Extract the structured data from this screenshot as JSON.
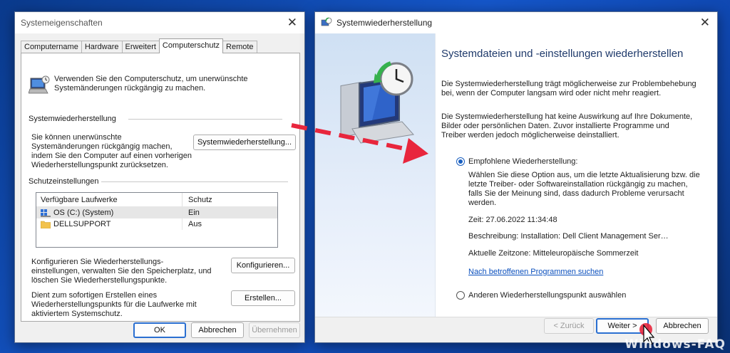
{
  "left_window": {
    "title": "Systemeigenschaften",
    "tabs": [
      {
        "label": "Computername"
      },
      {
        "label": "Hardware"
      },
      {
        "label": "Erweitert"
      },
      {
        "label": "Computerschutz",
        "active": true
      },
      {
        "label": "Remote"
      }
    ],
    "intro_text_1": "Verwenden Sie den Computerschutz, um unerwünschte",
    "intro_text_2": "Systemänderungen rückgängig zu machen.",
    "restore_section": {
      "label": "Systemwiederherstellung",
      "text_1": "Sie können unerwünschte",
      "text_2": "Systemänderungen rückgängig machen,",
      "text_3": "indem Sie den Computer auf einen vorherigen",
      "text_4": "Wiederherstellungspunkt zurücksetzen.",
      "button": "Systemwiederherstellung..."
    },
    "protection_section": {
      "label": "Schutzeinstellungen",
      "columns": [
        "Verfügbare Laufwerke",
        "Schutz"
      ],
      "rows": [
        {
          "drive": "OS (C:) (System)",
          "protection": "Ein",
          "icon": "system-drive-icon"
        },
        {
          "drive": "DELLSUPPORT",
          "protection": "Aus",
          "icon": "folder-icon"
        }
      ]
    },
    "configure": {
      "text_1": "Konfigurieren Sie Wiederherstellungs-",
      "text_2": "einstellungen, verwalten Sie den Speicherplatz, und",
      "text_3": "löschen Sie Wiederherstellungspunkte.",
      "button": "Konfigurieren..."
    },
    "create": {
      "text_1": "Dient zum sofortigen Erstellen eines",
      "text_2": "Wiederherstellungspunkts für die Laufwerke mit",
      "text_3": "aktiviertem Systemschutz.",
      "button": "Erstellen..."
    },
    "footer": {
      "ok": "OK",
      "cancel": "Abbrechen",
      "apply": "Übernehmen"
    }
  },
  "right_window": {
    "title": "Systemwiederherstellung",
    "heading": "Systemdateien und -einstellungen wiederherstellen",
    "para1_1": "Die Systemwiederherstellung trägt möglicherweise zur Problembehebung",
    "para1_2": "bei, wenn der Computer langsam wird oder nicht mehr reagiert.",
    "para2_1": "Die Systemwiederherstellung hat keine Auswirkung auf Ihre Dokumente,",
    "para2_2": "Bilder oder persönlichen Daten. Zuvor installierte Programme und",
    "para2_3": "Treiber werden jedoch möglicherweise deinstalliert.",
    "option_recommended": {
      "label": "Empfohlene Wiederherstellung:",
      "desc_1": "Wählen Sie diese Option aus, um die letzte Aktualisierung bzw. die",
      "desc_2": "letzte Treiber- oder Softwareinstallation rückgängig zu machen,",
      "desc_3": "falls Sie der Meinung sind, dass dadurch Probleme verursacht",
      "desc_4": "werden.",
      "time": "Zeit: 27.06.2022 11:34:48",
      "description": "Beschreibung: Installation: Dell Client Management Ser…",
      "timezone": "Aktuelle Zeitzone: Mitteleuropäische Sommerzeit",
      "link": "Nach betroffenen Programmen suchen"
    },
    "option_other": {
      "label": "Anderen Wiederherstellungspunkt auswählen"
    },
    "footer": {
      "back": "< Zurück",
      "next": "Weiter >",
      "cancel": "Abbrechen"
    }
  },
  "watermark": "Windows-FAQ",
  "colors": {
    "arrow": "#e8263d",
    "accent": "#1a5fc0",
    "desktop": "#1556c9"
  }
}
